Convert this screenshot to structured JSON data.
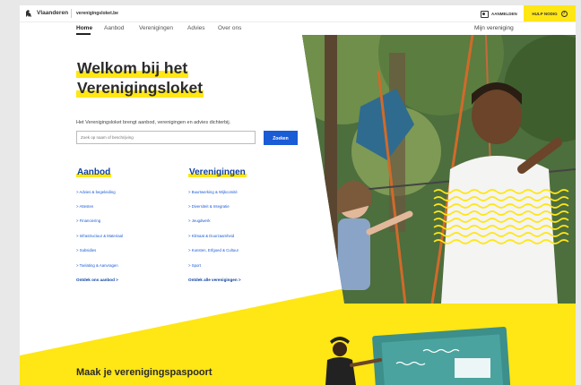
{
  "topbar": {
    "brand": "Vlaanderen",
    "site": "verenigingsloket.be",
    "login_label": "AANMELDEN",
    "help_label": "HULP NODIG"
  },
  "nav": {
    "items": [
      "Home",
      "Aanbod",
      "Verenigingen",
      "Advies",
      "Over ons"
    ],
    "right": "Mijn vereniging"
  },
  "hero": {
    "title_line1": "Welkom bij het",
    "title_line2": "Verenigingsloket",
    "intro": "Het Verenigingsloket brengt aanbod, verenigingen en advies dichterbij.",
    "search_placeholder": "Zoek op naam of beschrijving",
    "search_button": "Zoeken"
  },
  "aanbod": {
    "title": "Aanbod",
    "links": [
      "> Advies & begeleiding",
      "> Attesten",
      "> Financiering",
      "> Infrastructuur & Materiaal",
      "> Subsidies",
      "> Toelating & Aanvragen"
    ],
    "more": "Ontdek ons aanbod >"
  },
  "verenigingen": {
    "title": "Verenigingen",
    "links": [
      "> Buurtwerking & Wijkcomité",
      "> Diversiteit & Integratie",
      "> Jeugdwerk",
      "> Klimaat & Duurzaamheid",
      "> Kunsten, Erfgoed & Cultuur",
      "> Sport"
    ],
    "more": "Ontdek alle verenigingen >"
  },
  "bottom": {
    "title": "Maak je verenigingspaspoort"
  },
  "colors": {
    "accent_yellow": "#ffe615",
    "link_blue": "#1a5bd6",
    "heading_blue": "#0c3fa3"
  }
}
